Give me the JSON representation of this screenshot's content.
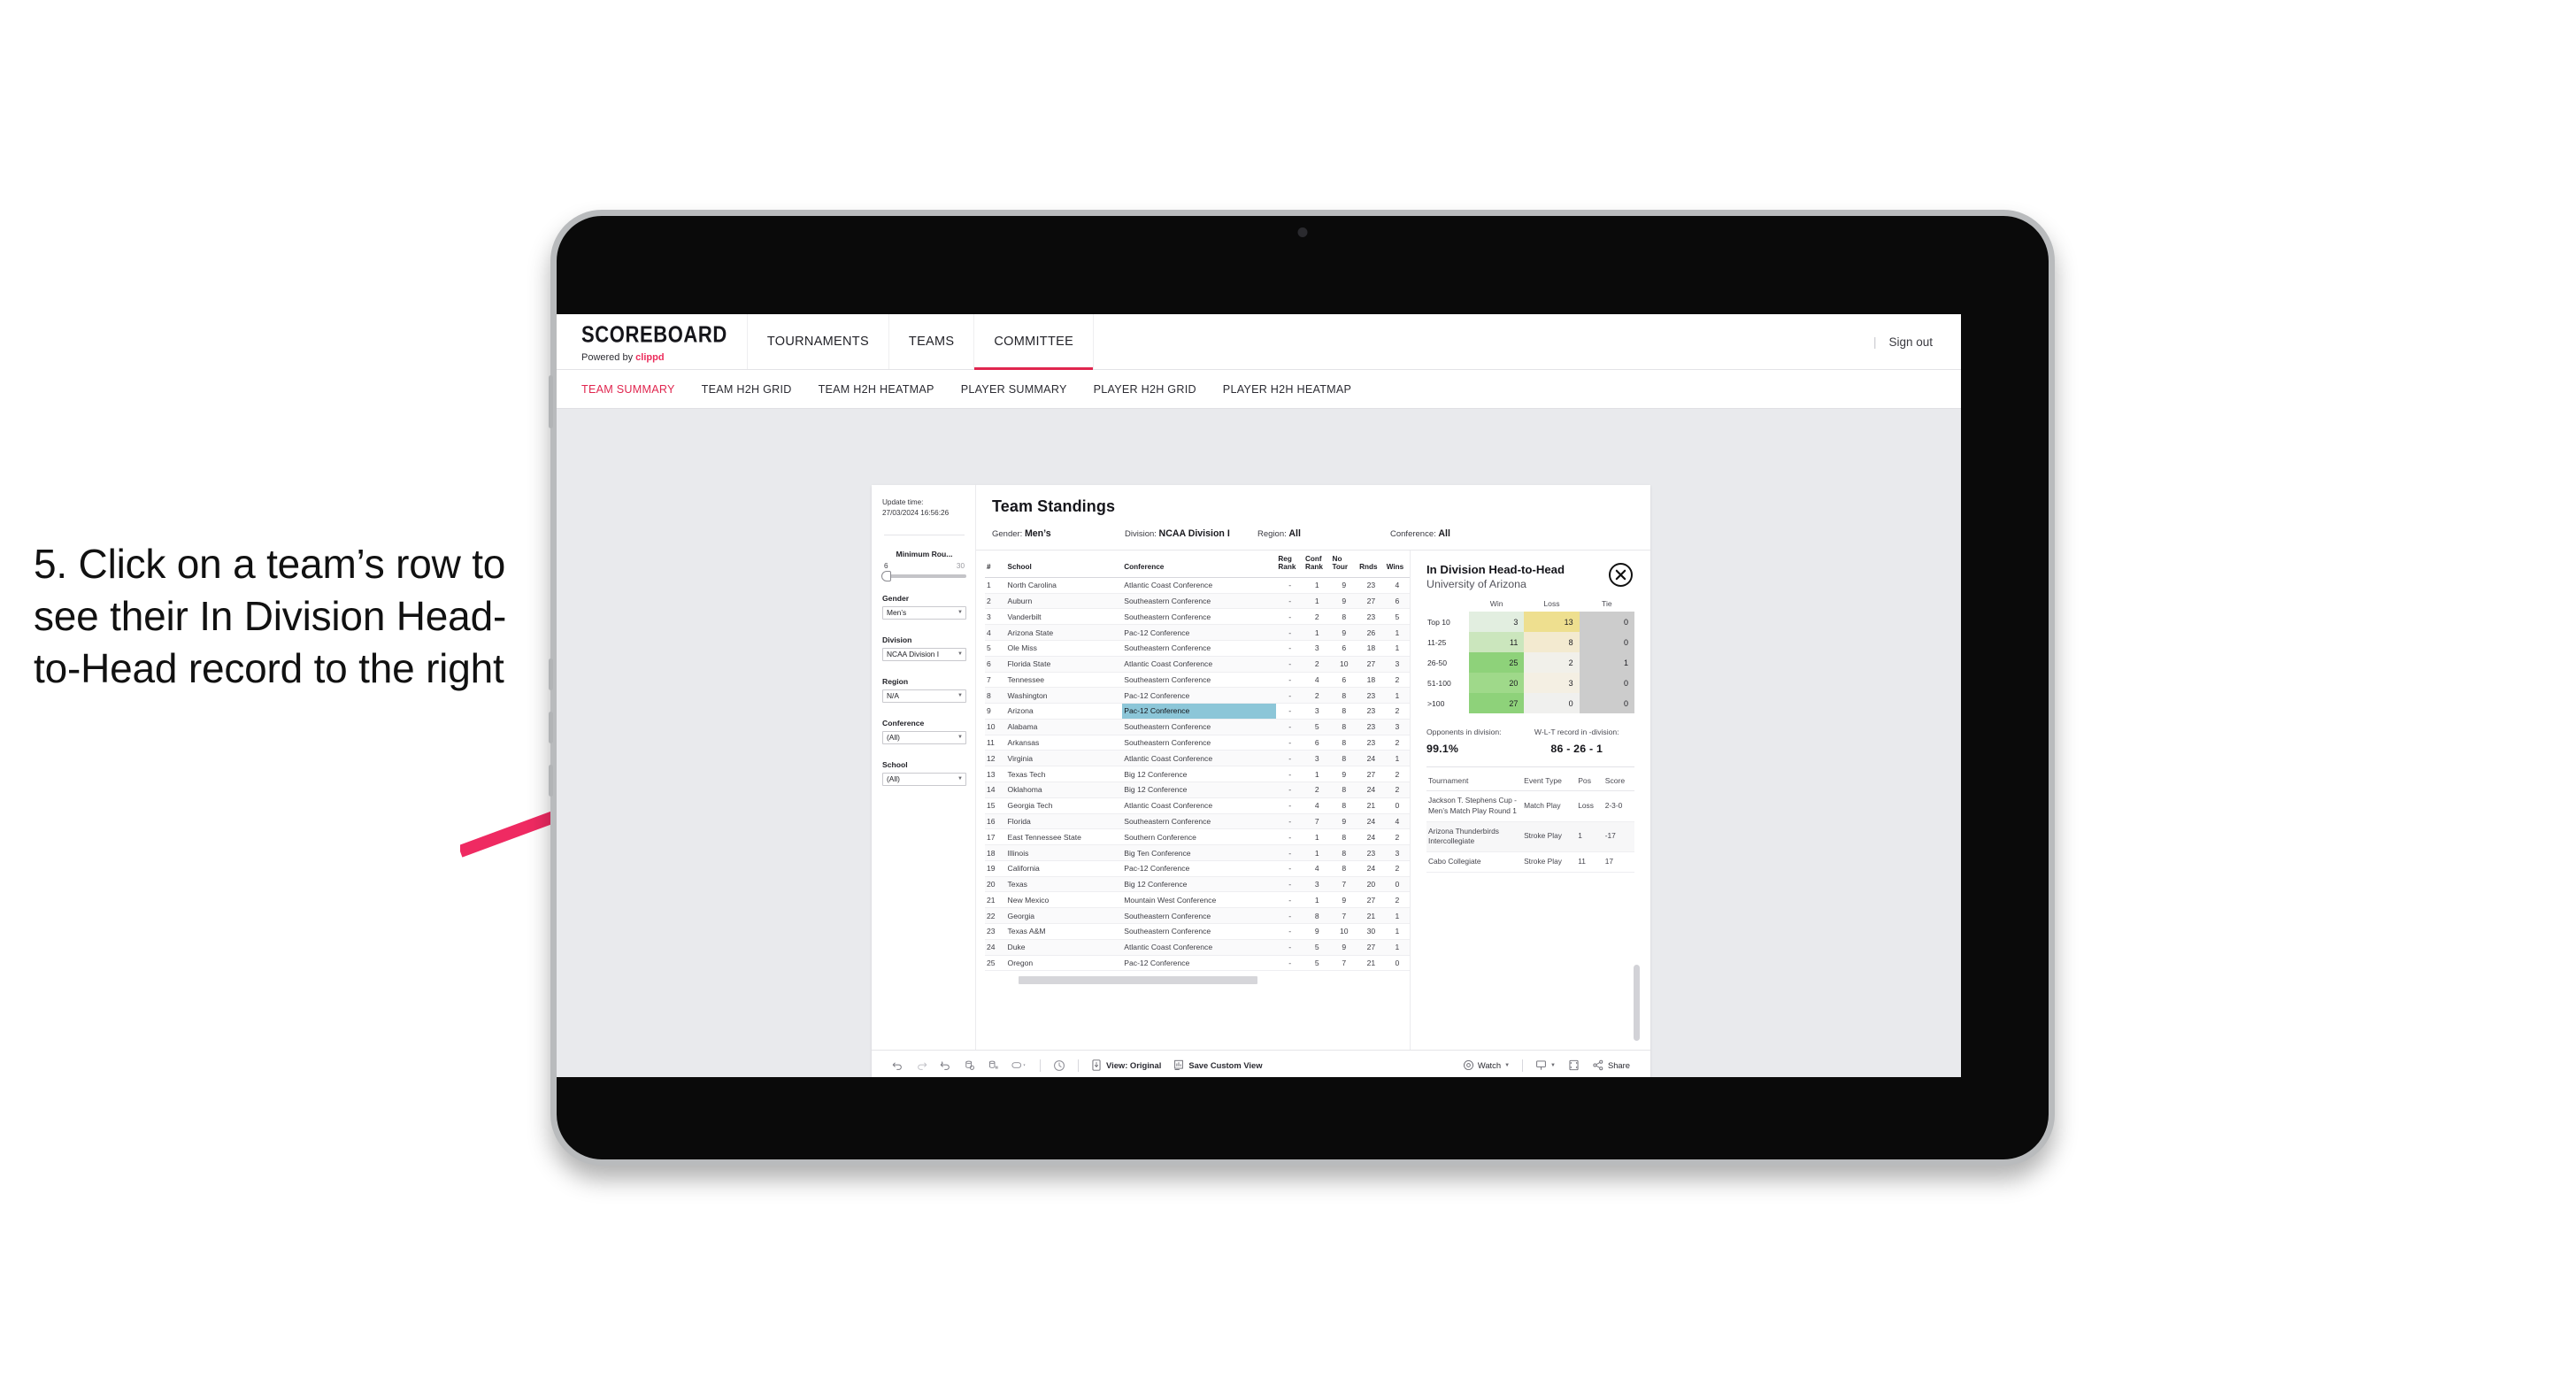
{
  "annotation": {
    "text": "5. Click on a team’s row to see their In Division Head-to-Head record to the right",
    "arrow_color": "#ef2a62"
  },
  "app": {
    "brand": {
      "title": "SCOREBOARD",
      "powered_prefix": "Powered by ",
      "powered_name": "clippd"
    },
    "top_nav": [
      {
        "label": "TOURNAMENTS",
        "active": false
      },
      {
        "label": "TEAMS",
        "active": false
      },
      {
        "label": "COMMITTEE",
        "active": true
      }
    ],
    "sign_out": "Sign out",
    "sub_nav": [
      {
        "label": "TEAM SUMMARY",
        "active": true
      },
      {
        "label": "TEAM H2H GRID",
        "active": false
      },
      {
        "label": "TEAM H2H HEATMAP",
        "active": false
      },
      {
        "label": "PLAYER SUMMARY",
        "active": false
      },
      {
        "label": "PLAYER H2H GRID",
        "active": false
      },
      {
        "label": "PLAYER H2H HEATMAP",
        "active": false
      }
    ],
    "accent_color": "#e0264f"
  },
  "filters": {
    "update_time_label": "Update time:",
    "update_time_value": "27/03/2024 16:56:26",
    "slider": {
      "label": "Minimum Rou...",
      "min": "6",
      "max": "30"
    },
    "selects": [
      {
        "label": "Gender",
        "value": "Men’s",
        "caret": "chevron-down"
      },
      {
        "label": "Division",
        "value": "NCAA Division I",
        "caret": "chevron-down"
      },
      {
        "label": "Region",
        "value": "N/A",
        "caret": "chevron-down"
      },
      {
        "label": "Conference",
        "value": "(All)",
        "caret": "chevron-down"
      },
      {
        "label": "School",
        "value": "(All)",
        "caret": "chevron-down"
      }
    ]
  },
  "standings": {
    "title": "Team Standings",
    "meta": [
      {
        "label": "Gender:",
        "value": "Men’s"
      },
      {
        "label": "Division:",
        "value": "NCAA Division I"
      },
      {
        "label": "Region:",
        "value": "All"
      },
      {
        "label": "Conference:",
        "value": "All"
      }
    ],
    "columns": [
      "#",
      "School",
      "Conference",
      "Reg Rank",
      "Conf Rank",
      "No Tour",
      "Rnds",
      "Wins"
    ],
    "highlighted_row_index": 8,
    "rows": [
      {
        "rank": "1",
        "school": "North Carolina",
        "conference": "Atlantic Coast Conference",
        "reg": "-",
        "conf": "1",
        "notour": "9",
        "rnds": "23",
        "wins": "4"
      },
      {
        "rank": "2",
        "school": "Auburn",
        "conference": "Southeastern Conference",
        "reg": "-",
        "conf": "1",
        "notour": "9",
        "rnds": "27",
        "wins": "6"
      },
      {
        "rank": "3",
        "school": "Vanderbilt",
        "conference": "Southeastern Conference",
        "reg": "-",
        "conf": "2",
        "notour": "8",
        "rnds": "23",
        "wins": "5"
      },
      {
        "rank": "4",
        "school": "Arizona State",
        "conference": "Pac-12 Conference",
        "reg": "-",
        "conf": "1",
        "notour": "9",
        "rnds": "26",
        "wins": "1"
      },
      {
        "rank": "5",
        "school": "Ole Miss",
        "conference": "Southeastern Conference",
        "reg": "-",
        "conf": "3",
        "notour": "6",
        "rnds": "18",
        "wins": "1"
      },
      {
        "rank": "6",
        "school": "Florida State",
        "conference": "Atlantic Coast Conference",
        "reg": "-",
        "conf": "2",
        "notour": "10",
        "rnds": "27",
        "wins": "3"
      },
      {
        "rank": "7",
        "school": "Tennessee",
        "conference": "Southeastern Conference",
        "reg": "-",
        "conf": "4",
        "notour": "6",
        "rnds": "18",
        "wins": "2"
      },
      {
        "rank": "8",
        "school": "Washington",
        "conference": "Pac-12 Conference",
        "reg": "-",
        "conf": "2",
        "notour": "8",
        "rnds": "23",
        "wins": "1"
      },
      {
        "rank": "9",
        "school": "Arizona",
        "conference": "Pac-12 Conference",
        "reg": "-",
        "conf": "3",
        "notour": "8",
        "rnds": "23",
        "wins": "2"
      },
      {
        "rank": "10",
        "school": "Alabama",
        "conference": "Southeastern Conference",
        "reg": "-",
        "conf": "5",
        "notour": "8",
        "rnds": "23",
        "wins": "3"
      },
      {
        "rank": "11",
        "school": "Arkansas",
        "conference": "Southeastern Conference",
        "reg": "-",
        "conf": "6",
        "notour": "8",
        "rnds": "23",
        "wins": "2"
      },
      {
        "rank": "12",
        "school": "Virginia",
        "conference": "Atlantic Coast Conference",
        "reg": "-",
        "conf": "3",
        "notour": "8",
        "rnds": "24",
        "wins": "1"
      },
      {
        "rank": "13",
        "school": "Texas Tech",
        "conference": "Big 12 Conference",
        "reg": "-",
        "conf": "1",
        "notour": "9",
        "rnds": "27",
        "wins": "2"
      },
      {
        "rank": "14",
        "school": "Oklahoma",
        "conference": "Big 12 Conference",
        "reg": "-",
        "conf": "2",
        "notour": "8",
        "rnds": "24",
        "wins": "2"
      },
      {
        "rank": "15",
        "school": "Georgia Tech",
        "conference": "Atlantic Coast Conference",
        "reg": "-",
        "conf": "4",
        "notour": "8",
        "rnds": "21",
        "wins": "0"
      },
      {
        "rank": "16",
        "school": "Florida",
        "conference": "Southeastern Conference",
        "reg": "-",
        "conf": "7",
        "notour": "9",
        "rnds": "24",
        "wins": "4"
      },
      {
        "rank": "17",
        "school": "East Tennessee State",
        "conference": "Southern Conference",
        "reg": "-",
        "conf": "1",
        "notour": "8",
        "rnds": "24",
        "wins": "2"
      },
      {
        "rank": "18",
        "school": "Illinois",
        "conference": "Big Ten Conference",
        "reg": "-",
        "conf": "1",
        "notour": "8",
        "rnds": "23",
        "wins": "3"
      },
      {
        "rank": "19",
        "school": "California",
        "conference": "Pac-12 Conference",
        "reg": "-",
        "conf": "4",
        "notour": "8",
        "rnds": "24",
        "wins": "2"
      },
      {
        "rank": "20",
        "school": "Texas",
        "conference": "Big 12 Conference",
        "reg": "-",
        "conf": "3",
        "notour": "7",
        "rnds": "20",
        "wins": "0"
      },
      {
        "rank": "21",
        "school": "New Mexico",
        "conference": "Mountain West Conference",
        "reg": "-",
        "conf": "1",
        "notour": "9",
        "rnds": "27",
        "wins": "2"
      },
      {
        "rank": "22",
        "school": "Georgia",
        "conference": "Southeastern Conference",
        "reg": "-",
        "conf": "8",
        "notour": "7",
        "rnds": "21",
        "wins": "1"
      },
      {
        "rank": "23",
        "school": "Texas A&M",
        "conference": "Southeastern Conference",
        "reg": "-",
        "conf": "9",
        "notour": "10",
        "rnds": "30",
        "wins": "1"
      },
      {
        "rank": "24",
        "school": "Duke",
        "conference": "Atlantic Coast Conference",
        "reg": "-",
        "conf": "5",
        "notour": "9",
        "rnds": "27",
        "wins": "1"
      },
      {
        "rank": "25",
        "school": "Oregon",
        "conference": "Pac-12 Conference",
        "reg": "-",
        "conf": "5",
        "notour": "7",
        "rnds": "21",
        "wins": "0"
      }
    ]
  },
  "h2h": {
    "title": "In Division Head-to-Head",
    "subtitle": "University of Arizona",
    "close_icon": "close-icon",
    "opponents_caption": "Opponents in division:",
    "opponents_value": "99.1%",
    "record_caption": "W-L-T record in -division:",
    "record_value": "86 - 26 - 1",
    "tournament_columns": [
      "Tournament",
      "Event Type",
      "Pos",
      "Score"
    ],
    "tournaments": [
      {
        "name": "Jackson T. Stephens Cup - Men’s Match Play Round 1",
        "type": "Match Play",
        "pos": "Loss",
        "score": "2-3-0"
      },
      {
        "name": "Arizona Thunderbirds Intercollegiate",
        "type": "Stroke Play",
        "pos": "1",
        "score": "-17"
      },
      {
        "name": "Cabo Collegiate",
        "type": "Stroke Play",
        "pos": "11",
        "score": "17"
      }
    ]
  },
  "chart_data": {
    "type": "heatmap",
    "title": "In Division Head-to-Head",
    "subtitle": "University of Arizona",
    "columns": [
      "Win",
      "Loss",
      "Tie"
    ],
    "rows": [
      "Top 10",
      "11-25",
      "26-50",
      "51-100",
      ">100"
    ],
    "values": [
      [
        3,
        13,
        0
      ],
      [
        11,
        8,
        0
      ],
      [
        25,
        2,
        1
      ],
      [
        20,
        3,
        0
      ],
      [
        27,
        0,
        0
      ]
    ],
    "cell_colors": [
      [
        "#e2eee0",
        "#eedf8f",
        "#cccccc"
      ],
      [
        "#cbe6bd",
        "#f3ead0",
        "#cccccc"
      ],
      [
        "#8ed27a",
        "#f1f0ea",
        "#cccccc"
      ],
      [
        "#9fd98a",
        "#f4efe3",
        "#cccccc"
      ],
      [
        "#8ed27a",
        "#f0f0ee",
        "#cccccc"
      ]
    ],
    "legend_position": "none",
    "grid": false
  },
  "toolbar": {
    "items": [
      {
        "icon": "undo-icon",
        "label": ""
      },
      {
        "icon": "redo-icon",
        "label": ""
      },
      {
        "icon": "revert-icon",
        "label": ""
      },
      {
        "icon": "refresh-data-icon",
        "label": ""
      },
      {
        "icon": "pause-auto-update-icon",
        "label": ""
      },
      {
        "icon": "highlight-icon",
        "label": ""
      }
    ],
    "view_label": "View: Original",
    "save_label": "Save Custom View",
    "watch_label": "Watch",
    "share_label": "Share",
    "view_icon": "device-view-icon",
    "save_icon": "save-view-icon",
    "watch_icon": "watch-icon",
    "comment_icon": "comment-icon",
    "fullscreen_icon": "fullscreen-icon",
    "share_icon": "share-icon"
  }
}
